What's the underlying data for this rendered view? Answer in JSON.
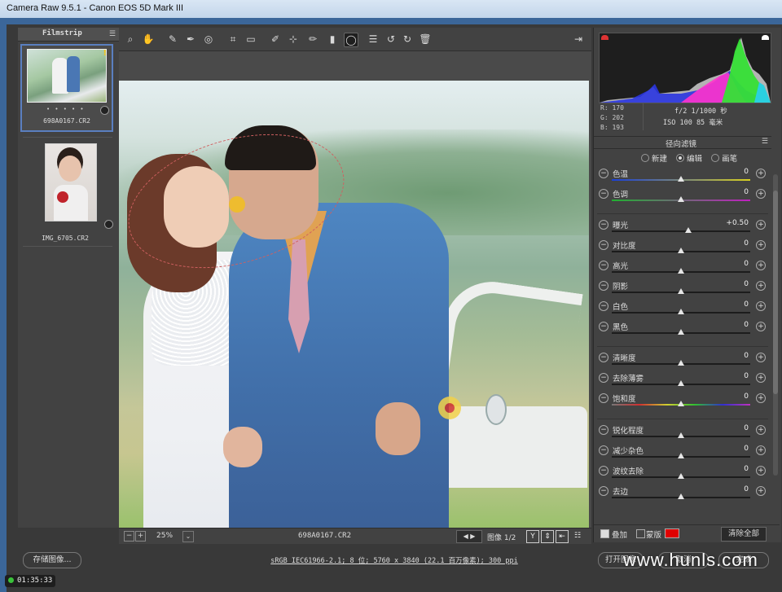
{
  "window": {
    "title": "Camera Raw 9.5.1 -  Canon EOS 5D Mark III"
  },
  "filmstrip": {
    "header": "Filmstrip",
    "items": [
      {
        "name": "698A0167.CR2",
        "stars": "• • • • •",
        "selected": true
      },
      {
        "name": "IMG_6705.CR2",
        "selected": false
      }
    ]
  },
  "toolbar": {
    "icons": [
      "zoom-icon",
      "hand-icon",
      "white-balance-icon",
      "color-sampler-icon",
      "target-adjust-icon",
      "crop-icon",
      "straighten-icon",
      "spot-removal-icon",
      "red-eye-icon",
      "adjustment-brush-icon",
      "graduated-filter-icon",
      "radial-filter-icon",
      "preferences-icon",
      "rotate-ccw-icon",
      "rotate-cw-icon",
      "trash-icon"
    ],
    "fullscreen_icon": "fullscreen-icon"
  },
  "image_bar": {
    "zoom": "25%",
    "filename": "698A0167.CR2",
    "image_label": "图像 1/2"
  },
  "info": {
    "r": "R:  170",
    "g": "G:  202",
    "b": "B:  193",
    "aperture_shutter": "f/2   1/1000 秒",
    "iso_focal": "ISO 100   85 毫米"
  },
  "panel": {
    "title": "径向滤镜",
    "modes": {
      "new": "新建",
      "edit": "编辑",
      "brush": "画笔"
    },
    "sliders": [
      {
        "label": "色温",
        "value": "0",
        "pos": 0.5
      },
      {
        "label": "色调",
        "value": "0",
        "pos": 0.5
      },
      {
        "label": "曝光",
        "value": "+0.50",
        "pos": 0.55
      },
      {
        "label": "对比度",
        "value": "0",
        "pos": 0.5
      },
      {
        "label": "高光",
        "value": "0",
        "pos": 0.5
      },
      {
        "label": "阴影",
        "value": "0",
        "pos": 0.5
      },
      {
        "label": "白色",
        "value": "0",
        "pos": 0.5
      },
      {
        "label": "黑色",
        "value": "0",
        "pos": 0.5
      },
      {
        "label": "清晰度",
        "value": "0",
        "pos": 0.5
      },
      {
        "label": "去除薄雾",
        "value": "0",
        "pos": 0.5
      },
      {
        "label": "饱和度",
        "value": "0",
        "pos": 0.5
      },
      {
        "label": "锐化程度",
        "value": "0",
        "pos": 0.5
      },
      {
        "label": "减少杂色",
        "value": "0",
        "pos": 0.5
      },
      {
        "label": "波纹去除",
        "value": "0",
        "pos": 0.5
      },
      {
        "label": "去边",
        "value": "0",
        "pos": 0.5
      }
    ],
    "overlay_label": "叠加",
    "mask_label": "蒙版",
    "mask_color": "#e00000",
    "clear_all": "清除全部"
  },
  "footer": {
    "save": "存储图像...",
    "workflow": "sRGB IEC61966-2.1; 8 位; 5760 x 3840 (22.1 百万像素); 300 ppi",
    "open": "打开图像",
    "cancel": "取消",
    "done": "完成"
  },
  "watermark": "www.hunls.com",
  "timer": "01:35:33"
}
